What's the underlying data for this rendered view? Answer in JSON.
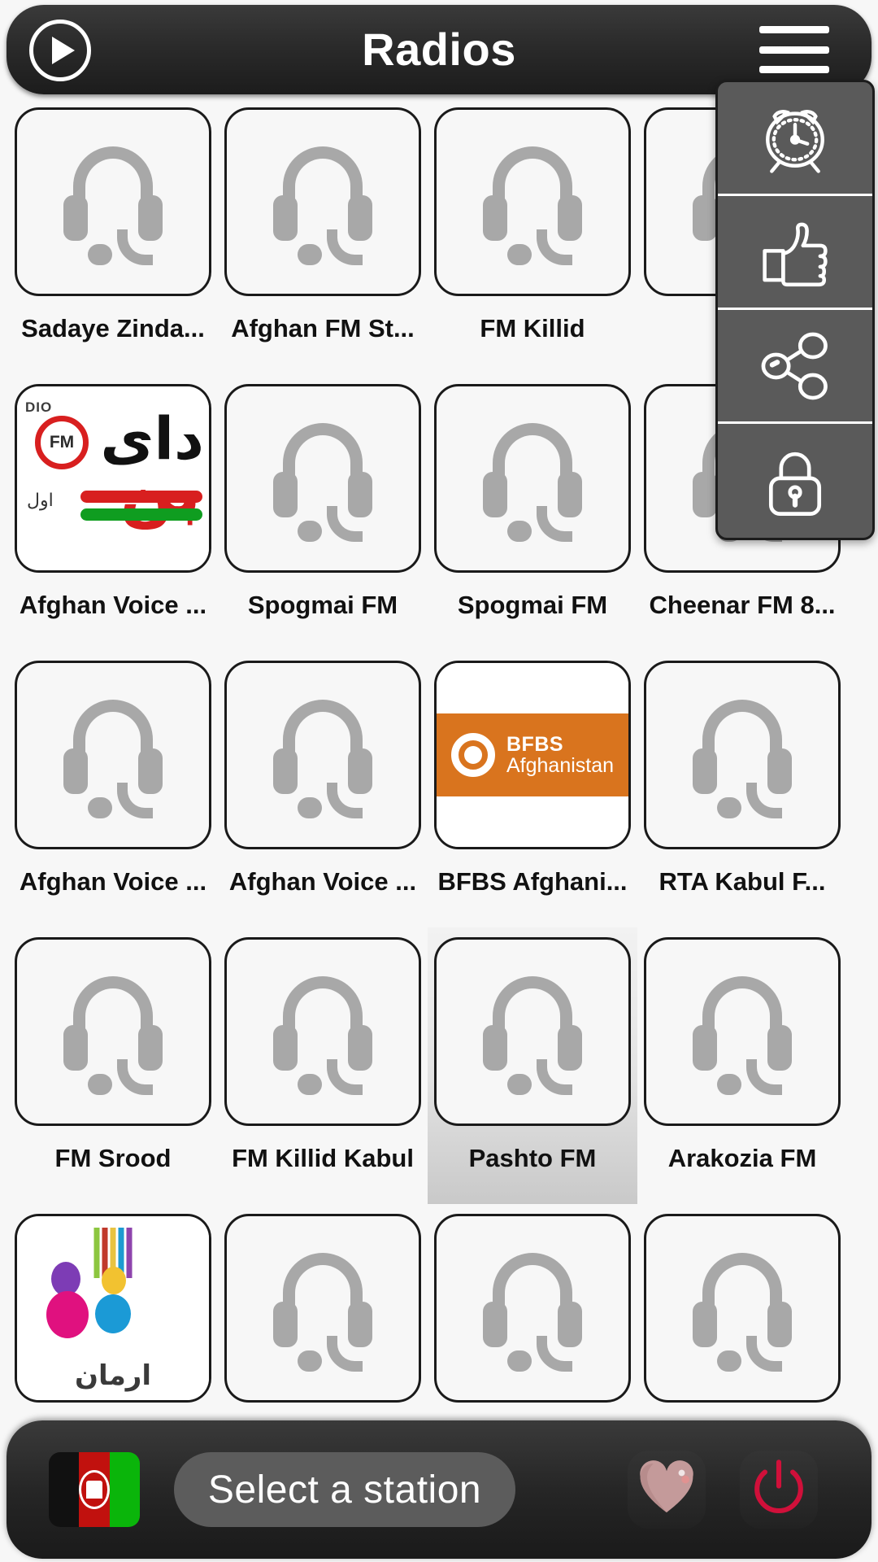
{
  "header": {
    "title": "Radios",
    "play_icon": "play-icon",
    "menu_icon": "hamburger-menu-icon"
  },
  "side_menu": {
    "items": [
      {
        "icon": "alarm-clock-icon",
        "name": "sleep-timer"
      },
      {
        "icon": "thumbs-up-icon",
        "name": "rate-app"
      },
      {
        "icon": "share-icon",
        "name": "share-app"
      },
      {
        "icon": "lock-icon",
        "name": "privacy-lock"
      }
    ]
  },
  "grid": {
    "rows": [
      [
        {
          "label": "Sadaye Zinda...",
          "art": "headset",
          "selected": false
        },
        {
          "label": "Afghan FM St...",
          "art": "headset",
          "selected": false
        },
        {
          "label": "FM Killid",
          "art": "headset",
          "selected": false
        },
        {
          "label": "",
          "art": "headset",
          "selected": false
        }
      ],
      [
        {
          "label": "Afghan Voice ...",
          "art": "afghan-voice-logo",
          "selected": false
        },
        {
          "label": "Spogmai FM",
          "art": "headset",
          "selected": false
        },
        {
          "label": "Spogmai FM",
          "art": "headset",
          "selected": false
        },
        {
          "label": "Cheenar FM 8...",
          "art": "headset",
          "selected": false
        }
      ],
      [
        {
          "label": "Afghan Voice ...",
          "art": "headset",
          "selected": false
        },
        {
          "label": "Afghan Voice ...",
          "art": "headset",
          "selected": false
        },
        {
          "label": "BFBS Afghani...",
          "art": "bfbs-logo",
          "selected": false
        },
        {
          "label": "RTA Kabul F...",
          "art": "headset",
          "selected": false
        }
      ],
      [
        {
          "label": "FM Srood",
          "art": "headset",
          "selected": false
        },
        {
          "label": "FM Killid Kabul",
          "art": "headset",
          "selected": false
        },
        {
          "label": "Pashto FM",
          "art": "headset",
          "selected": true
        },
        {
          "label": "Arakozia FM",
          "art": "headset",
          "selected": false
        }
      ],
      [
        {
          "label": "",
          "art": "arman-logo",
          "selected": false
        },
        {
          "label": "",
          "art": "headset",
          "selected": false
        },
        {
          "label": "",
          "art": "headset",
          "selected": false
        },
        {
          "label": "",
          "art": "headset",
          "selected": false
        }
      ]
    ]
  },
  "logos": {
    "afghan_voice": {
      "radio_text": "DIO",
      "fm_text": "FM",
      "script_main": "دای",
      "script_red": "بن",
      "script_small": "اول"
    },
    "bfbs": {
      "line1": "BFBS",
      "line2": "Afghanistan",
      "accent": "#d9741e"
    },
    "arman": {
      "script": "ارمان"
    }
  },
  "bottom_bar": {
    "flag_name": "afghanistan-flag",
    "station_label": "Select a station",
    "favorite_icon": "heart-icon",
    "power_icon": "power-icon"
  },
  "colors": {
    "header_bg": "#2b2b2b",
    "page_bg": "#f7f7f7",
    "menu_bg": "#5a5a5a",
    "heart": "#c49a9a",
    "power": "#d0103a",
    "flag_red": "#c1110e",
    "flag_green": "#0ab50a"
  }
}
